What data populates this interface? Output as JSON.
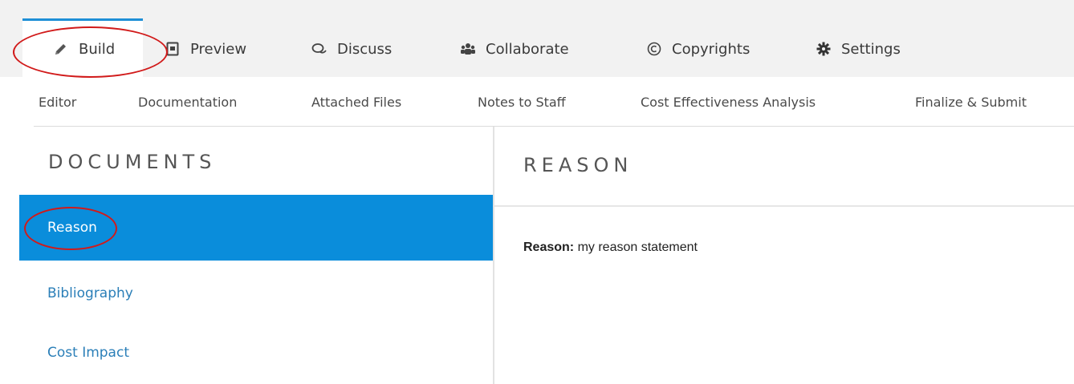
{
  "top_tabs": [
    {
      "label": "Build",
      "icon": "pencil-icon",
      "active": true
    },
    {
      "label": "Preview",
      "icon": "document-icon",
      "active": false
    },
    {
      "label": "Discuss",
      "icon": "chat-icon",
      "active": false
    },
    {
      "label": "Collaborate",
      "icon": "users-icon",
      "active": false
    },
    {
      "label": "Copyrights",
      "icon": "copyright-icon",
      "active": false
    },
    {
      "label": "Settings",
      "icon": "gear-icon",
      "active": false
    }
  ],
  "sub_nav": [
    "Editor",
    "Documentation",
    "Attached Files",
    "Notes to Staff",
    "Cost Effectiveness Analysis",
    "Finalize & Submit"
  ],
  "documents": {
    "heading": "DOCUMENTS",
    "items": [
      {
        "label": "Reason",
        "active": true
      },
      {
        "label": "Bibliography",
        "active": false
      },
      {
        "label": "Cost Impact",
        "active": false
      }
    ]
  },
  "content": {
    "heading": "REASON",
    "field_label": "Reason:",
    "field_value": "my reason statement"
  },
  "colors": {
    "accent": "#0a8ddb",
    "tab_indicator": "#1e8fd6",
    "annotation": "#d11a1a"
  }
}
